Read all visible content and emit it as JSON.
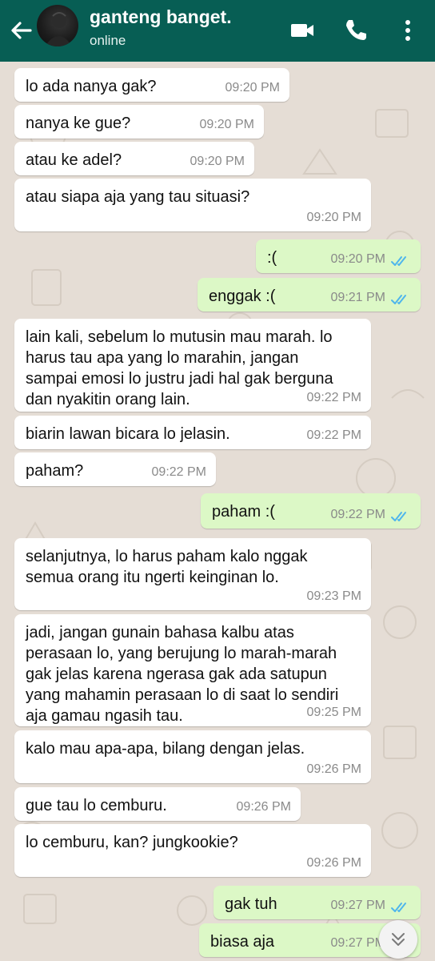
{
  "header": {
    "contact_name": "ganteng banget.",
    "status": "online",
    "background": "#075e54"
  },
  "messages": [
    {
      "direction": "in",
      "text": "lo ada nanya gak?",
      "time": "09:20 PM"
    },
    {
      "direction": "in",
      "text": "nanya ke gue?",
      "time": "09:20 PM"
    },
    {
      "direction": "in",
      "text": "atau ke adel?",
      "time": "09:20 PM"
    },
    {
      "direction": "in",
      "text": "atau siapa aja yang tau situasi?",
      "time": "09:20 PM"
    },
    {
      "direction": "out",
      "text": ":(",
      "time": "09:20 PM",
      "status": "read"
    },
    {
      "direction": "out",
      "text": "enggak :(",
      "time": "09:21 PM",
      "status": "read"
    },
    {
      "direction": "in",
      "text": "lain kali,  sebelum lo mutusin mau marah. lo\nharus tau apa yang lo marahin,  jangan\nsampai emosi lo justru jadi hal gak berguna\ndan nyakitin orang lain.",
      "time": "09:22 PM"
    },
    {
      "direction": "in",
      "text": "biarin lawan bicara lo jelasin.",
      "time": "09:22 PM"
    },
    {
      "direction": "in",
      "text": "paham?",
      "time": "09:22 PM"
    },
    {
      "direction": "out",
      "text": "paham :(",
      "time": "09:22 PM",
      "status": "read"
    },
    {
      "direction": "in",
      "text": "selanjutnya,  lo harus paham kalo nggak\nsemua orang itu ngerti keinginan lo.",
      "time": "09:23 PM"
    },
    {
      "direction": "in",
      "text": "jadi,  jangan gunain bahasa kalbu atas\nperasaan lo, yang berujung lo marah-marah\ngak jelas karena ngerasa gak ada satupun\nyang mahamin perasaan lo di saat lo sendiri\naja gamau ngasih tau.",
      "time": "09:25 PM"
    },
    {
      "direction": "in",
      "text": "kalo mau apa-apa,  bilang dengan jelas.",
      "time": "09:26 PM"
    },
    {
      "direction": "in",
      "text": "gue tau lo cemburu.",
      "time": "09:26 PM"
    },
    {
      "direction": "in",
      "text": "lo cemburu,  kan?  jungkookie?",
      "time": "09:26 PM"
    },
    {
      "direction": "out",
      "text": "gak tuh",
      "time": "09:27 PM",
      "status": "read"
    },
    {
      "direction": "out",
      "text": "biasa aja",
      "time": "09:27 PM",
      "status": "read"
    }
  ],
  "colors": {
    "incoming_bubble": "#ffffff",
    "outgoing_bubble": "#dcf8c6",
    "read_ticks": "#4fb6ec",
    "wallpaper": "#e5ddd5"
  },
  "icons": [
    "back-arrow-icon",
    "video-call-icon",
    "phone-icon",
    "more-vert-icon",
    "double-check-icon",
    "scroll-down-icon"
  ]
}
